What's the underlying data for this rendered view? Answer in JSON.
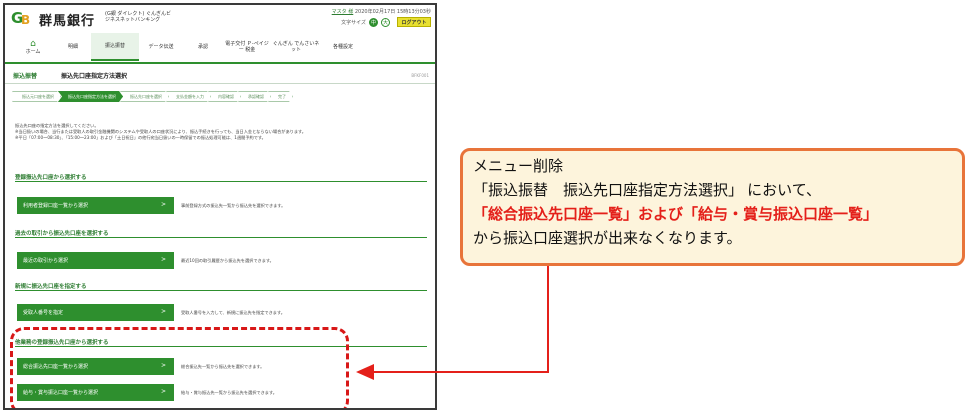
{
  "header": {
    "logo": "GB",
    "bank_name": "群馬銀行",
    "service_name": "(G銀 ダイレクト) ぐんぎんビジネスネットバンキング",
    "user_name": "マスタ 様",
    "datetime": "2020年02月17日 15時13分03秒",
    "font_size_label": "文字サイズ",
    "font_sizes": [
      "中",
      "大"
    ],
    "logout": "ログアウト"
  },
  "nav": {
    "items": [
      {
        "label": "ホーム",
        "icon": "home-icon"
      },
      {
        "label": "明細"
      },
      {
        "label": "振込振替"
      },
      {
        "label": "データ伝送"
      },
      {
        "label": "承認"
      },
      {
        "label": "電子交付 Ｐ-ペイジー 税金"
      },
      {
        "label": "ぐんぎん でんさいネット"
      },
      {
        "label": "各種設定"
      }
    ]
  },
  "page": {
    "category": "振込振替",
    "title": "振込先口座指定方法選択",
    "screen_id": "BFKF001"
  },
  "steps": [
    "振込元口座を選択",
    "振込先口座指定方法を選択",
    "振込先口座を選択",
    "支払金額を入力",
    "内容確認",
    "承認確認",
    "完了"
  ],
  "description": [
    "振込先口座の指定方法を選択してください。",
    "※当日扱いの場合、当行または受取人の取引金融機関のシステムや受取人の口座状況により、振込手続きを行っても、当日入金とならない場合があります。",
    "※平日「07:00〜08:30」、「15:00〜23:00」および「土日祝日」の他行宛当日扱いの一時保留での振込処理可能は、1週間予約です。"
  ],
  "sections": [
    {
      "heading": "登録振込先口座から選択する",
      "button": "利用者登録口座一覧から選択",
      "note": "事前登録方式の振込先一覧から振込先を選択できます。"
    },
    {
      "heading": "過去の取引から振込先口座を選択する",
      "button": "最近の取引から選択",
      "note": "最近10回の取引履歴から振込先を選択できます。"
    },
    {
      "heading": "新規に振込先口座を指定する",
      "button": "受取人番号を指定",
      "note": "受取人番号を入力して、新規に振込先を指定できます。"
    },
    {
      "heading": "他業務の登録振込先口座から選択する",
      "buttons": [
        {
          "button": "総合振込先口座一覧から選択",
          "note": "総合振込先一覧から振込先を選択できます。"
        },
        {
          "button": "給与・賞与振込口座一覧から選択",
          "note": "給与・賞与振込先一覧から振込先を選択できます。"
        }
      ]
    }
  ],
  "callout": {
    "line1": "メニュー削除",
    "line2": "「振込振替　振込先口座指定方法選択」 において、",
    "line3": "「総合振込先口座一覧」および「給与・賞与振込口座一覧」",
    "line4": "から振込口座選択が出来なくなります。"
  },
  "colors": {
    "brand_green": "#2e8f2e",
    "highlight_red": "#d81818",
    "callout_border": "#e8743a",
    "callout_bg": "#fdf4dc"
  }
}
